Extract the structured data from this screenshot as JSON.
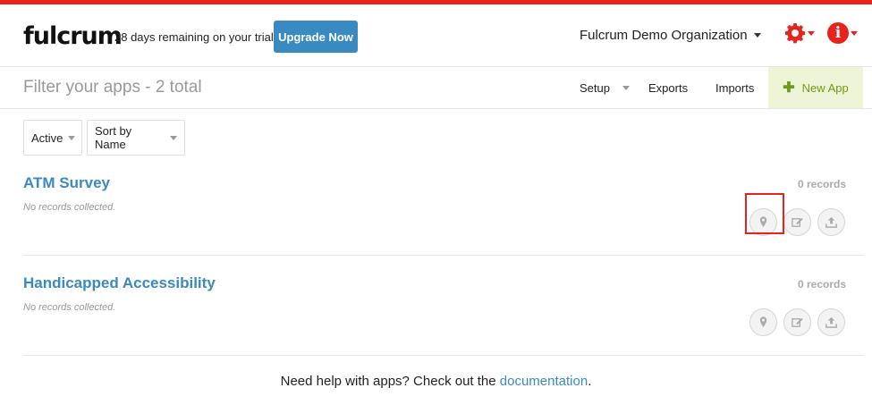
{
  "header": {
    "logo": "fulcrum",
    "trial_text": "28 days remaining on your trial",
    "upgrade_label": "Upgrade Now",
    "organization": "Fulcrum Demo Organization"
  },
  "toolbar": {
    "filter_placeholder": "Filter your apps - 2 total",
    "setup_label": "Setup",
    "exports_label": "Exports",
    "imports_label": "Imports",
    "new_app_label": "New App"
  },
  "filters": {
    "status": "Active",
    "sort": "Sort by Name"
  },
  "apps": [
    {
      "name": "ATM Survey",
      "subtitle": "No records collected.",
      "records": "0 records"
    },
    {
      "name": "Handicapped Accessibility",
      "subtitle": "No records collected.",
      "records": "0 records"
    }
  ],
  "footer": {
    "text": "Need help with apps? Check out the ",
    "link": "documentation",
    "end": "."
  },
  "colors": {
    "brand_red": "#e8231c",
    "link_blue": "#3a8ac2",
    "new_app_green": "#6f9a1a"
  },
  "icons": [
    "gear-icon",
    "info-icon",
    "map-pin-icon",
    "edit-icon",
    "upload-icon",
    "plus-icon"
  ]
}
